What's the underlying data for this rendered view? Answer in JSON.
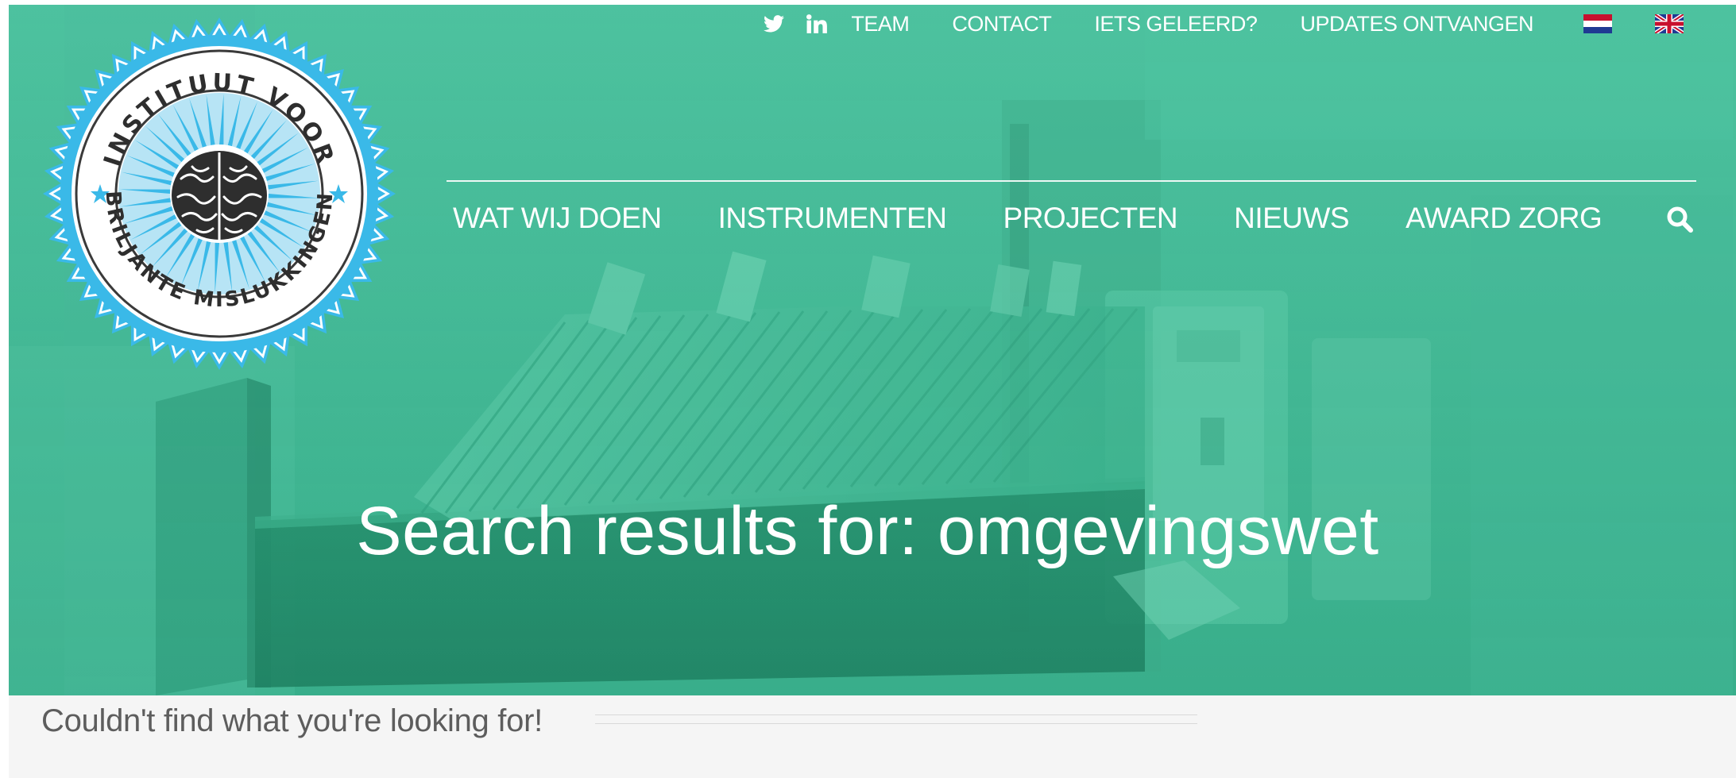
{
  "topnav": {
    "icons": [
      "twitter-icon",
      "linkedin-icon"
    ],
    "links": [
      "TEAM",
      "CONTACT",
      "IETS GELEERD?",
      "UPDATES ONTVANGEN"
    ],
    "flags": [
      "dutch-flag-icon",
      "uk-flag-icon"
    ]
  },
  "mainnav": {
    "items": [
      "WAT WIJ DOEN",
      "INSTRUMENTEN",
      "PROJECTEN",
      "NIEUWS",
      "AWARD ZORG"
    ]
  },
  "logo": {
    "top_text": "INSTITUUT VOOR",
    "bottom_text": "BRILJANTE MISLUKKINGEN"
  },
  "hero": {
    "title": "Search results for: omgevingswet"
  },
  "content": {
    "message": "Couldn't find what you're looking for!"
  },
  "colors": {
    "hero_green": "#3fb592",
    "logo_blue": "#3ab9e8",
    "text_gray": "#5d5d5d"
  }
}
